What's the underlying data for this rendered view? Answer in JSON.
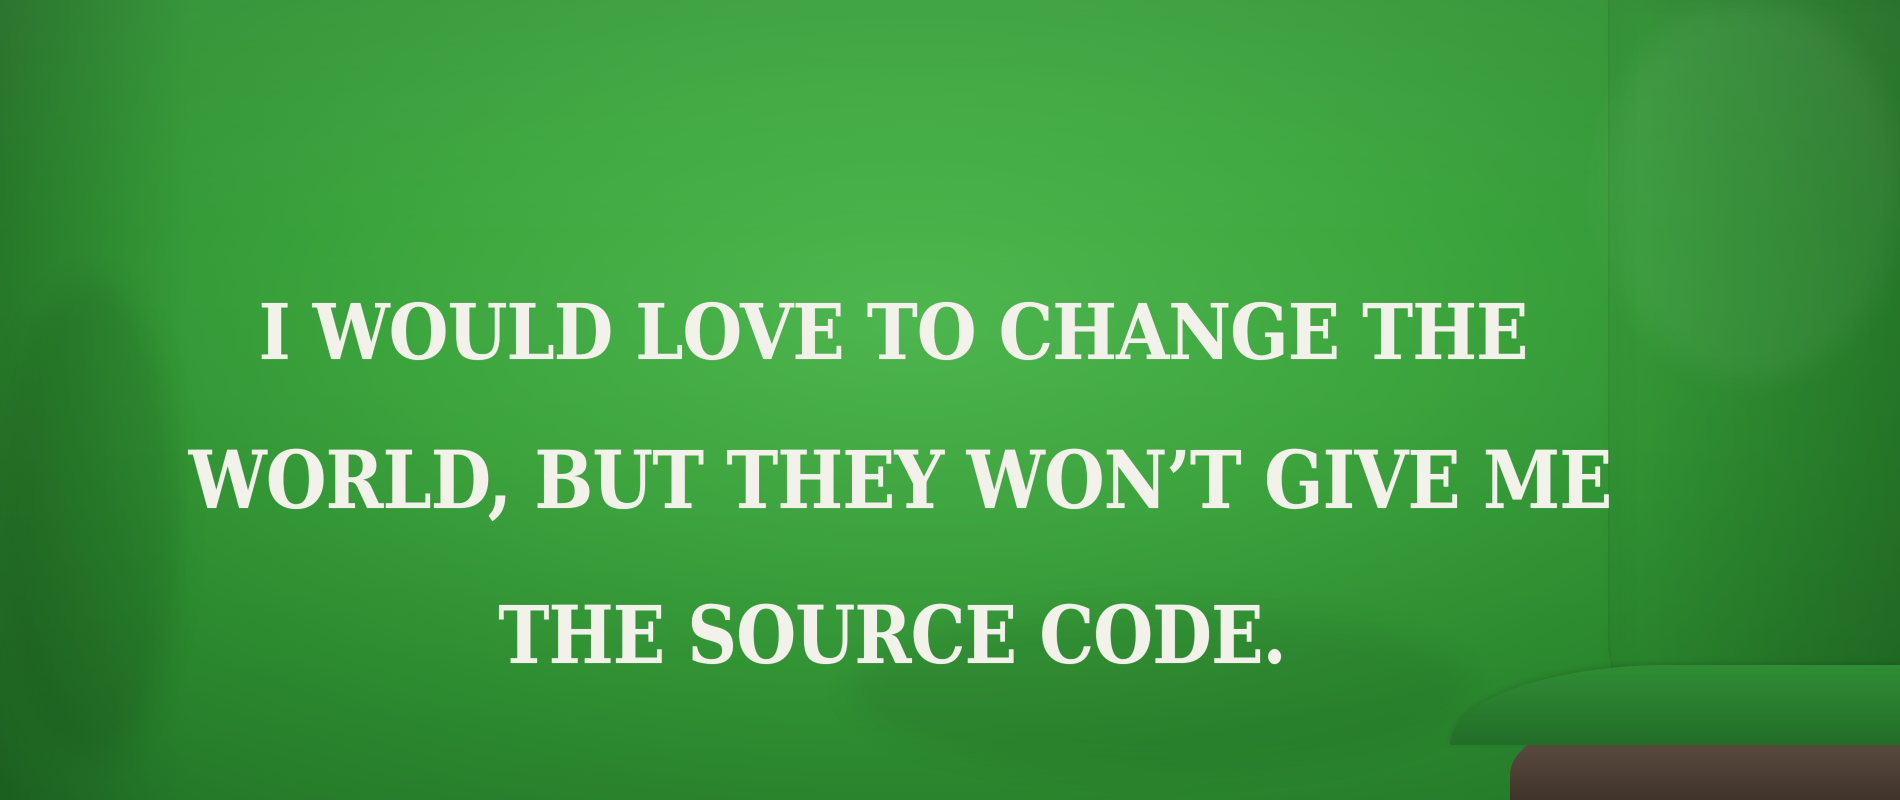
{
  "shirt": {
    "print_lines": [
      "I WOULD LOVE TO CHANGE THE",
      "WORLD, BUT THEY WON’T GIVE ME",
      "THE SOURCE CODE."
    ],
    "colors": {
      "fabric": "#3ea83f",
      "text": "#f2f2ea",
      "shadow": "#237a29",
      "skin": "#5a4b40"
    }
  }
}
